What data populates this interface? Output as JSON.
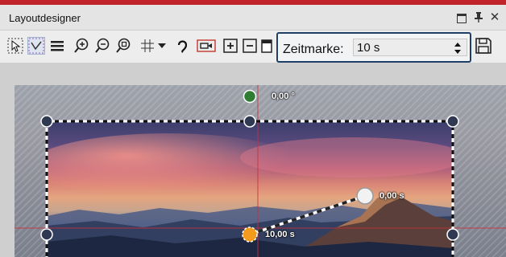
{
  "window": {
    "title": "Layoutdesigner",
    "controls": [
      "maximize-icon",
      "pin-icon",
      "close-icon"
    ]
  },
  "toolbar": {
    "tools": [
      "select-tool-icon",
      "curve-tool-icon",
      "list-icon",
      "zoom-in-icon",
      "zoom-out-icon",
      "zoom-fit-icon",
      "grid-icon",
      "dropdown-arrow-icon",
      "path-icon",
      "camera-icon",
      "add-keyframe-icon",
      "remove-keyframe-icon",
      "copy-icon",
      "save-icon"
    ],
    "zeitmarke_label": "Zeitmarke:",
    "zeitmarke_value": "10 s"
  },
  "canvas": {
    "rotation_label": "0,00 °",
    "keyframe_start_label": "10,00 s",
    "keyframe_end_label": "0,00 s"
  },
  "colors": {
    "accent_bar": "#c0242a",
    "focus_border": "#1f3f66",
    "rotation_handle": "#2e7d32",
    "keyframe_active": "#f29b1d"
  }
}
